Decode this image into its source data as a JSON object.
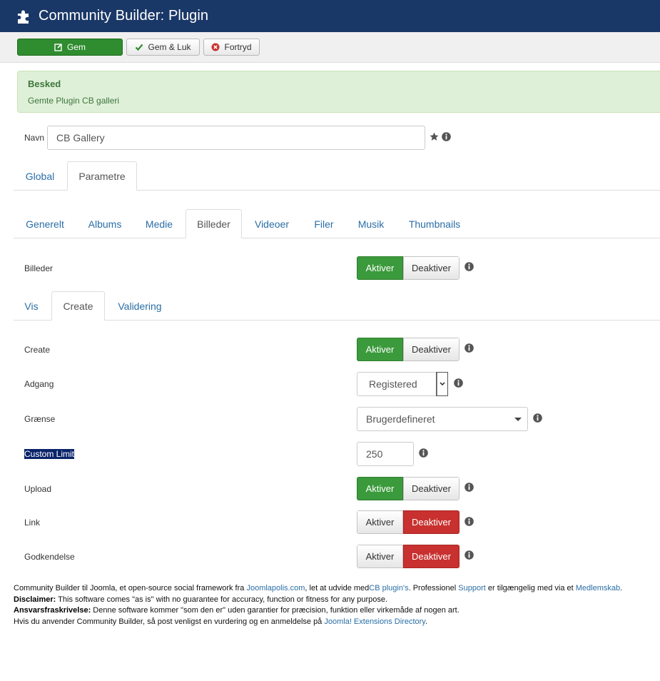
{
  "header": {
    "title": "Community Builder: Plugin",
    "logo_icon": "puzzle-icon"
  },
  "toolbar": {
    "save_label": "Gem",
    "save_close_label": "Gem & Luk",
    "cancel_label": "Fortryd"
  },
  "alert": {
    "heading": "Besked",
    "message": "Gemte Plugin CB galleri"
  },
  "name_field": {
    "label": "Navn",
    "value": "CB Gallery"
  },
  "main_tabs": [
    {
      "label": "Global"
    },
    {
      "label": "Parametre"
    }
  ],
  "sub_tabs": [
    {
      "label": "Generelt"
    },
    {
      "label": "Albums"
    },
    {
      "label": "Medie"
    },
    {
      "label": "Billeder"
    },
    {
      "label": "Videoer"
    },
    {
      "label": "Filer"
    },
    {
      "label": "Musik"
    },
    {
      "label": "Thumbnails"
    }
  ],
  "billeder_label": "Billeder",
  "inner_tabs": [
    {
      "label": "Vis"
    },
    {
      "label": "Create"
    },
    {
      "label": "Validering"
    }
  ],
  "toggle_labels": {
    "on": "Aktiver",
    "off": "Deaktiver"
  },
  "rows": {
    "create": {
      "label": "Create",
      "state": "on"
    },
    "access": {
      "label": "Adgang",
      "value": "Registered"
    },
    "limit": {
      "label": "Grænse",
      "value": "Brugerdefineret"
    },
    "custom_limit": {
      "label": "Custom Limit",
      "value": "250"
    },
    "upload": {
      "label": "Upload",
      "state": "on"
    },
    "link": {
      "label": "Link",
      "state": "off"
    },
    "approval": {
      "label": "Godkendelse",
      "state": "off"
    }
  },
  "footer": {
    "l1_a": "Community Builder til Joomla, et open-source social framework fra ",
    "l1_link1": "Joomlapolis.com",
    "l1_b": ", let at udvide med",
    "l1_link2": "CB plugin's",
    "l1_c": ". Professionel ",
    "l1_link3": "Support",
    "l1_d": " er tilgængelig med via et ",
    "l1_link4": "Medlemskab",
    "l1_e": ".",
    "l2_bold": "Disclaimer:",
    "l2_text": " This software comes \"as is\" with no guarantee for accuracy, function or fitness for any purpose.",
    "l3_bold": "Ansvarsfraskrivelse:",
    "l3_text": " Denne software kommer \"som den er\" uden garantier for præcision, funktion eller virkemåde af nogen art.",
    "l4_text": "Hvis du anvender Community Builder, så post venligst en vurdering og en anmeldelse på ",
    "l4_link": "Joomla! Extensions Directory",
    "l4_end": "."
  },
  "colors": {
    "header_bg": "#1a3867",
    "primary_green": "#3b9a3c",
    "danger_red": "#c8312f",
    "link_blue": "#2a6ea6"
  }
}
